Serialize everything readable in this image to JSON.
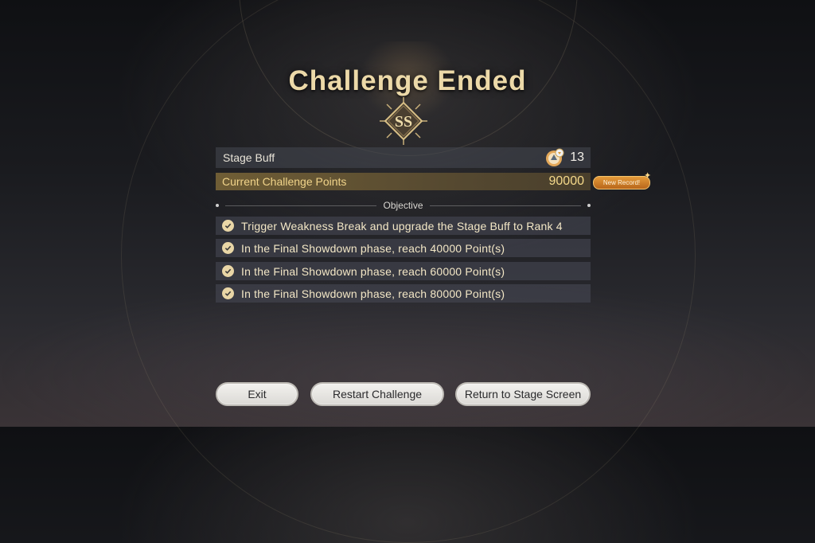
{
  "result": {
    "title": "Challenge Ended",
    "rank": "SS"
  },
  "stage_buff": {
    "label": "Stage Buff",
    "count": "13",
    "icon": "stage-buff-icon"
  },
  "points": {
    "label": "Current Challenge Points",
    "value": "90000",
    "record_badge": "New Record!"
  },
  "objective": {
    "heading": "Objective",
    "items": [
      "Trigger Weakness Break and upgrade the Stage Buff to Rank 4",
      "In the Final Showdown phase, reach 40000 Point(s)",
      "In the Final Showdown phase, reach 60000 Point(s)",
      "In the Final Showdown phase, reach 80000 Point(s)"
    ]
  },
  "buttons": {
    "exit": "Exit",
    "restart": "Restart Challenge",
    "return": "Return to Stage Screen"
  },
  "colors": {
    "title_gold": "#ecd9a8",
    "points_bar": "#78643a",
    "record_orange": "#e49b3a",
    "check": "#e9d6a6"
  }
}
